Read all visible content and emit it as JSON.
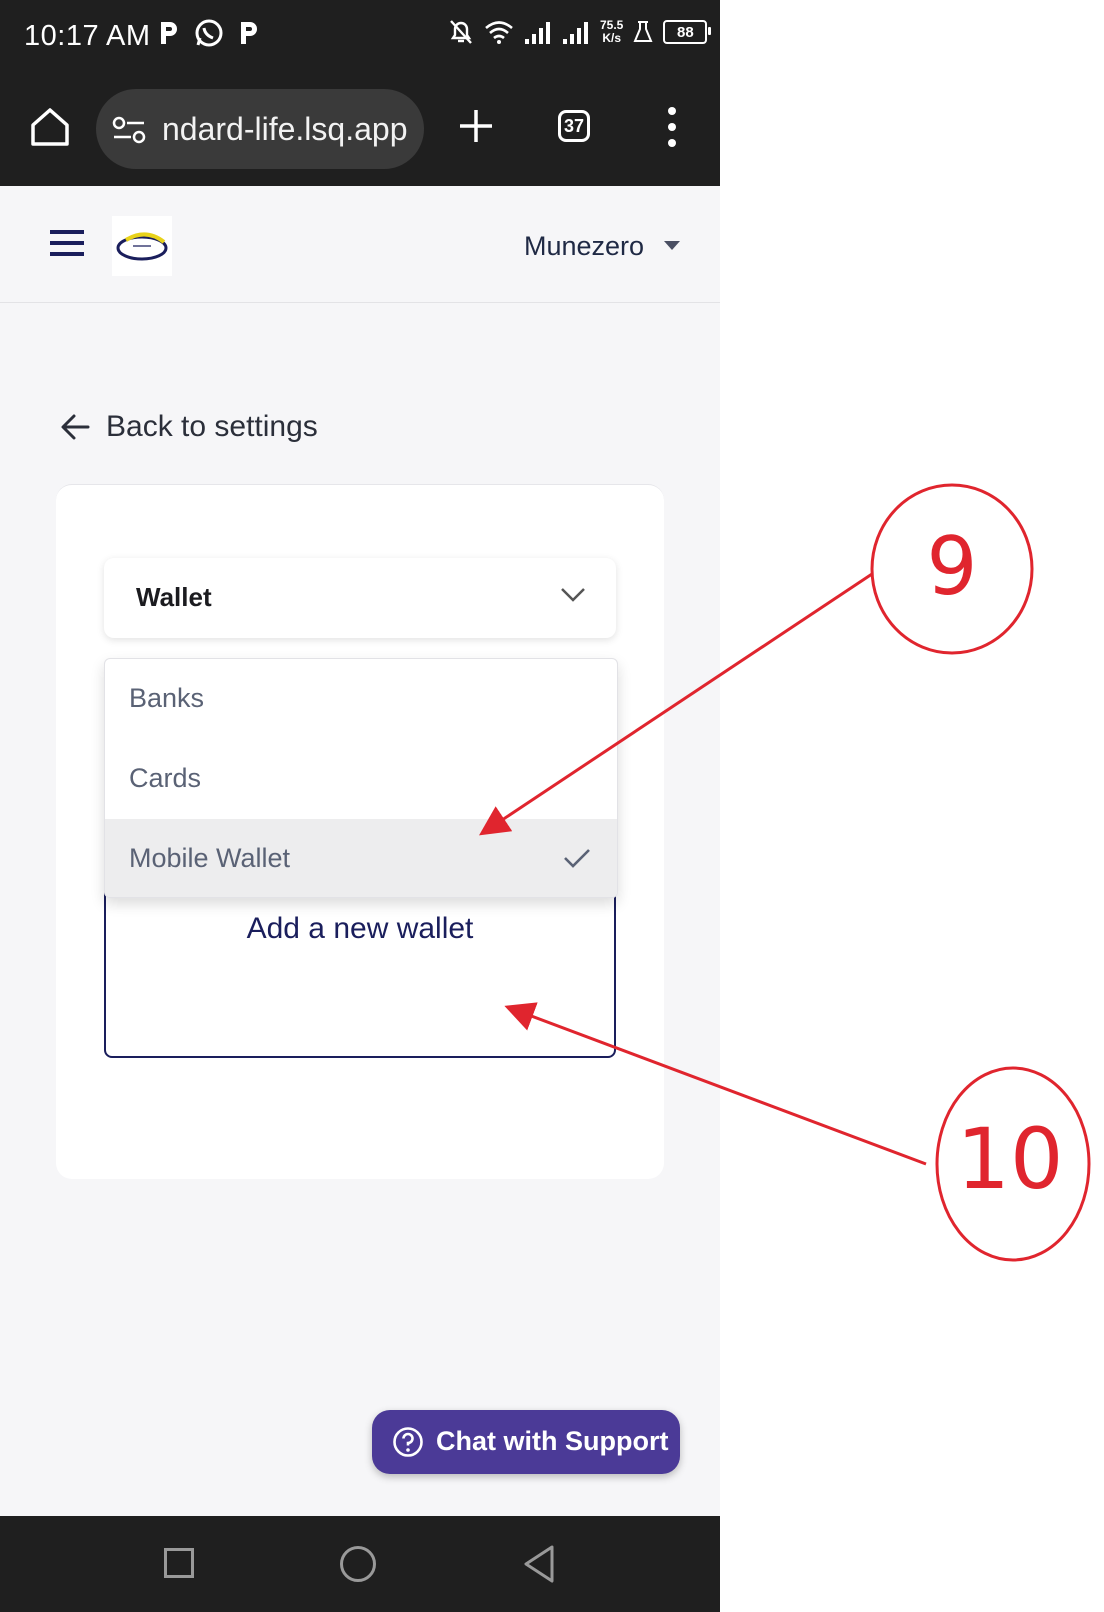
{
  "status_bar": {
    "time": "10:17 AM",
    "network_speed_value": "75.5",
    "network_speed_unit": "K/s",
    "battery": "88",
    "icons": [
      "p-icon",
      "whatsapp-icon",
      "p-icon",
      "bell-off-icon",
      "wifi-icon",
      "signal-icon",
      "signal-icon",
      "lab-icon",
      "battery-icon"
    ]
  },
  "browser": {
    "url": "ndard-life.lsq.app",
    "tab_count": "37"
  },
  "app_header": {
    "user_name": "Munezero"
  },
  "back_link": {
    "label": "Back to settings"
  },
  "payment_select": {
    "selected_value": "Wallet",
    "options": [
      "Banks",
      "Cards",
      "Mobile Wallet"
    ],
    "checked_option": "Mobile Wallet"
  },
  "add_wallet": {
    "label": "Add a new wallet"
  },
  "support": {
    "label": "Chat with Support"
  },
  "annotations": {
    "marker_9": "9",
    "marker_10": "10",
    "color": "#e0252e"
  },
  "colors": {
    "accent_navy": "#1a1e5c",
    "support_purple": "#4b3a97"
  }
}
